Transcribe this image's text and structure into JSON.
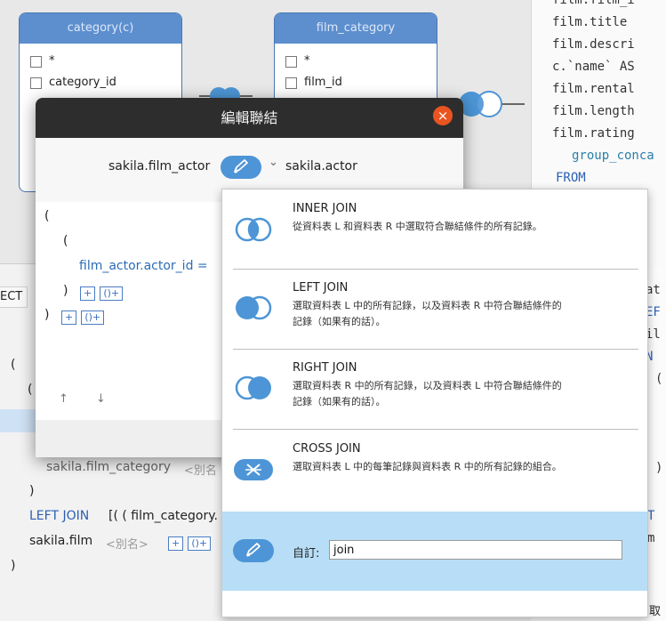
{
  "diagram": {
    "table1": {
      "title": "category(c)",
      "rows": [
        {
          "label": "*"
        },
        {
          "label": "category_id"
        }
      ]
    },
    "table2": {
      "title": "film_category",
      "rows": [
        {
          "label": "*"
        },
        {
          "label": "film_id"
        }
      ]
    }
  },
  "sql_preview": {
    "lines": [
      {
        "text": "film.film_i",
        "style": "normal"
      },
      {
        "text": "film.title",
        "style": "normal"
      },
      {
        "text": "film.descri",
        "style": "normal"
      },
      {
        "text": "c.`name` AS",
        "style": "mixed"
      },
      {
        "text": "film.rental",
        "style": "normal"
      },
      {
        "text": "film.length",
        "style": "normal"
      },
      {
        "text": "film.rating",
        "style": "normal"
      },
      {
        "text": "group_conca",
        "style": "teal"
      },
      {
        "text": "FROM",
        "style": "kw"
      }
    ],
    "lower_fragments": [
      "at",
      "EF",
      "il",
      "N",
      "(",
      ")",
      "T",
      "m"
    ]
  },
  "background_builder": {
    "select_fragment": "ECT",
    "paren_open": "(",
    "paren_open2": "(",
    "row1_table": "sakila.film_category",
    "row1_alias": "<別名",
    "paren_close": ")",
    "join_kw": "LEFT JOIN",
    "join_cond": "[( ( film_category.",
    "row2_table": "sakila.film",
    "row2_alias": "<別名>",
    "plus": "+",
    "cond_btn": "()+",
    "paren_close2": ")",
    "corner_text": "取"
  },
  "dialog": {
    "title": "編輯聯結",
    "close_symbol": "×",
    "left_table": "sakila.film_actor",
    "right_table": "sakila.actor",
    "dropdown_arrow": "⌄",
    "tree": {
      "open1": "(",
      "open2": "(",
      "condition": "film_actor.actor_id =",
      "close1": ")",
      "close2": ")",
      "plus": "+",
      "cond_btn": "()+"
    },
    "move_up": "↑",
    "move_down": "↓"
  },
  "join_menu": {
    "options": [
      {
        "name": "INNER JOIN",
        "desc1": "從資料表 L 和資料表 R 中選取符合聯結條件的所有記錄。",
        "desc2": ""
      },
      {
        "name": "LEFT JOIN",
        "desc1": "選取資料表 L 中的所有記錄，以及資料表 R 中符合聯結條件的",
        "desc2": "記錄（如果有的話）。"
      },
      {
        "name": "RIGHT JOIN",
        "desc1": "選取資料表 R 中的所有記錄，以及資料表 L 中符合聯結條件的",
        "desc2": "記錄（如果有的話）。"
      },
      {
        "name": "CROSS JOIN",
        "desc1": "選取資料表 L 中的每筆記錄與資料表 R 中的所有記錄的組合。",
        "desc2": ""
      }
    ],
    "custom": {
      "label": "自訂:",
      "value": "join"
    }
  },
  "colors": {
    "accent": "#4d95d6",
    "selection": "#b7def6",
    "close": "#e95420",
    "titlebar": "#2d2d2d"
  }
}
